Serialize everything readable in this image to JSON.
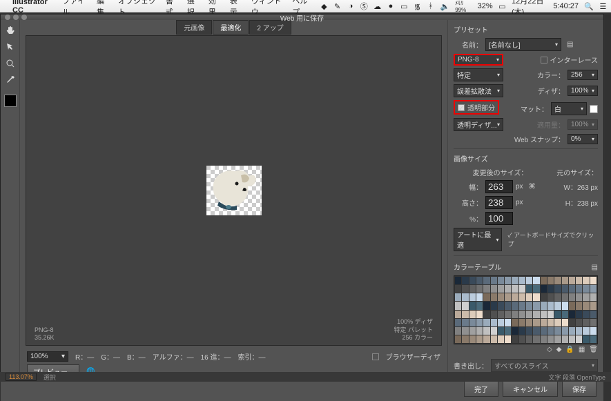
{
  "menubar": {
    "app": "Illustrator CC",
    "items": [
      "ファイル",
      "編集",
      "オブジェクト",
      "書式",
      "選択",
      "効果",
      "表示",
      "ウィンドウ",
      "ヘルプ"
    ],
    "status": {
      "memory": "ﾒﾓﾘ 99%",
      "battery": "32%",
      "date": "12月22日(木)",
      "time": "5:40:27"
    }
  },
  "dialog": {
    "title": "Web 用に保存",
    "tabs": [
      "元画像",
      "最適化",
      "2 アップ"
    ],
    "active_tab": 1,
    "canvas_info": {
      "format": "PNG-8",
      "size": "35.26K",
      "dither": "100% ディザ",
      "palette": "特定 パレット",
      "colors": "256 カラー"
    },
    "bottom": {
      "zoom": "100%",
      "R": "R：—",
      "G": "G：—",
      "B": "B：—",
      "alpha": "アルファ：—",
      "hex": "16 進：—",
      "index": "索引：—",
      "browser_dither": "ブラウザーディザ",
      "preview": "プレビュー..."
    },
    "buttons": {
      "done": "完了",
      "cancel": "キャンセル",
      "save": "保存"
    }
  },
  "preset": {
    "section": "プリセット",
    "name_label": "名前：",
    "name_value": "[名前なし]",
    "format": "PNG-8",
    "interlace": "インターレース",
    "reduction": "特定",
    "color_label": "カラー：",
    "color_value": "256",
    "dither_method": "誤差拡散法",
    "dither_label": "ディザ：",
    "dither_value": "100%",
    "transparency": "透明部分",
    "matte_label": "マット：",
    "matte_value": "白",
    "trans_dither": "透明ディザ...",
    "apply_label": "適用量：",
    "apply_value": "100%",
    "websnap_label": "Web スナップ：",
    "websnap_value": "0%"
  },
  "imagesize": {
    "section": "画像サイズ",
    "after_label": "変更後のサイズ：",
    "orig_label": "元のサイズ：",
    "w_label": "幅：",
    "w_value": "263",
    "w_unit": "px",
    "orig_w": "W：263 px",
    "h_label": "高さ：",
    "h_value": "238",
    "h_unit": "px",
    "orig_h": "H：238 px",
    "pct_label": "%：",
    "pct_value": "100",
    "fit": "アートに最適",
    "clip": "✓ アートボードサイズでクリップ"
  },
  "colortable": {
    "section": "カラーテーブル"
  },
  "export": {
    "label": "書き出し：",
    "value": "すべてのスライス"
  },
  "status": {
    "zoom": "113.07%",
    "sel": "選択",
    "mode": "文字   段落   OpenType"
  }
}
